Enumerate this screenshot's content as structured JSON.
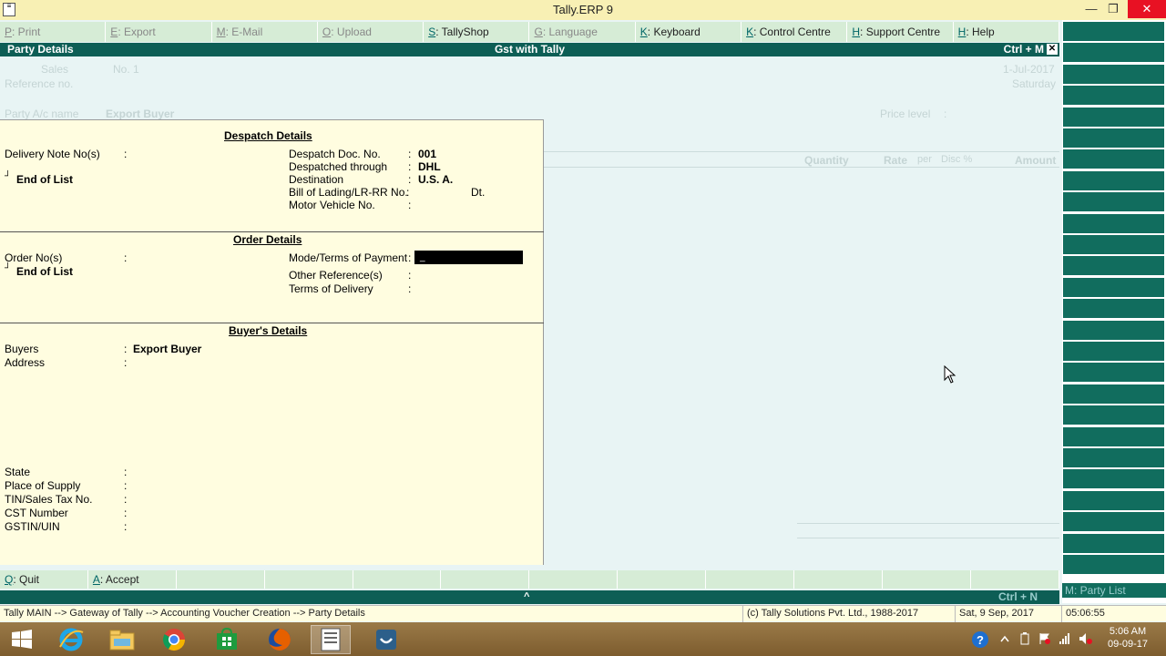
{
  "window": {
    "title": "Tally.ERP 9",
    "minimize": "—",
    "restore": "❐",
    "close": "✕"
  },
  "menu": [
    {
      "key": "P",
      "label": ": Print",
      "dim": true
    },
    {
      "key": "E",
      "label": ": Export",
      "dim": true
    },
    {
      "key": "M",
      "label": ": E-Mail",
      "dim": true
    },
    {
      "key": "O",
      "label": ": Upload",
      "dim": true
    },
    {
      "key": "S",
      "label": ": TallyShop",
      "dim": false
    },
    {
      "key": "G",
      "label": ": Language",
      "dim": true
    },
    {
      "key": "K",
      "label": ": Keyboard",
      "dim": false
    },
    {
      "key": "K",
      "label": ": Control Centre",
      "dim": false
    },
    {
      "key": "H",
      "label": ": Support Centre",
      "dim": false
    },
    {
      "key": "H",
      "label": ": Help",
      "dim": false
    }
  ],
  "header": {
    "left": "Party Details",
    "center": "Gst with Tally",
    "right": "Ctrl + M",
    "close": "✕"
  },
  "background": {
    "voucher_type": "Sales",
    "voucher_no": "No. 1",
    "date": "1-Jul-2017",
    "day": "Saturday",
    "reference": "Reference no.",
    "party_label": "Party A/c name",
    "party_value": "Export Buyer",
    "price_level": "Price level",
    "price_colon": ":",
    "columns": {
      "quantity": "Quantity",
      "rate": "Rate",
      "per": "per",
      "disc": "Disc %",
      "amount": "Amount"
    }
  },
  "despatch": {
    "heading": "Despatch Details",
    "delivery_note_label": "Delivery Note No(s)",
    "colon": ":",
    "end_of_list": "End of List",
    "end_marker": "┘",
    "doc_no_label": "Despatch Doc. No.",
    "doc_no_value": "001",
    "through_label": "Despatched through",
    "through_value": "DHL",
    "destination_label": "Destination",
    "destination_value": "U.S. A.",
    "bill_label": "Bill of Lading/LR-RR No.",
    "bill_dt": "Dt.",
    "vehicle_label": "Motor Vehicle No."
  },
  "order": {
    "heading": "Order Details",
    "order_no_label": "Order No(s)",
    "end_of_list": "End of List",
    "mode_label": "Mode/Terms of Payment",
    "mode_colon": ":",
    "mode_cursor": "_",
    "other_ref_label": "Other Reference(s)",
    "terms_label": "Terms of Delivery"
  },
  "buyer": {
    "heading": "Buyer's Details",
    "buyers_label": "Buyers",
    "buyers_value": "Export Buyer",
    "address_label": "Address",
    "state_label": "State",
    "supply_label": "Place of Supply",
    "tin_label": "TIN/Sales Tax No.",
    "cst_label": "CST Number",
    "gstin_label": "GSTIN/UIN"
  },
  "buttons": [
    {
      "key": "Q",
      "label": ": Quit"
    },
    {
      "key": "A",
      "label": ": Accept"
    },
    {
      "key": "",
      "label": ""
    },
    {
      "key": "",
      "label": ""
    },
    {
      "key": "",
      "label": ""
    },
    {
      "key": "",
      "label": ""
    },
    {
      "key": "",
      "label": ""
    },
    {
      "key": "",
      "label": ""
    },
    {
      "key": "",
      "label": ""
    },
    {
      "key": "",
      "label": ""
    },
    {
      "key": "",
      "label": ""
    },
    {
      "key": "",
      "label": ""
    }
  ],
  "bottom": {
    "right": "Ctrl + N",
    "chevron": "^",
    "party_list": "M: Party List"
  },
  "status": {
    "path": "Tally MAIN --> Gateway of Tally --> Accounting Voucher  Creation  --> Party Details",
    "copyright": "(c) Tally Solutions Pvt. Ltd., 1988-2017",
    "date": "Sat, 9 Sep, 2017",
    "time": "05:06:55"
  },
  "taskbar": {
    "clock_time": "5:06 AM",
    "clock_date": "09-09-17"
  }
}
